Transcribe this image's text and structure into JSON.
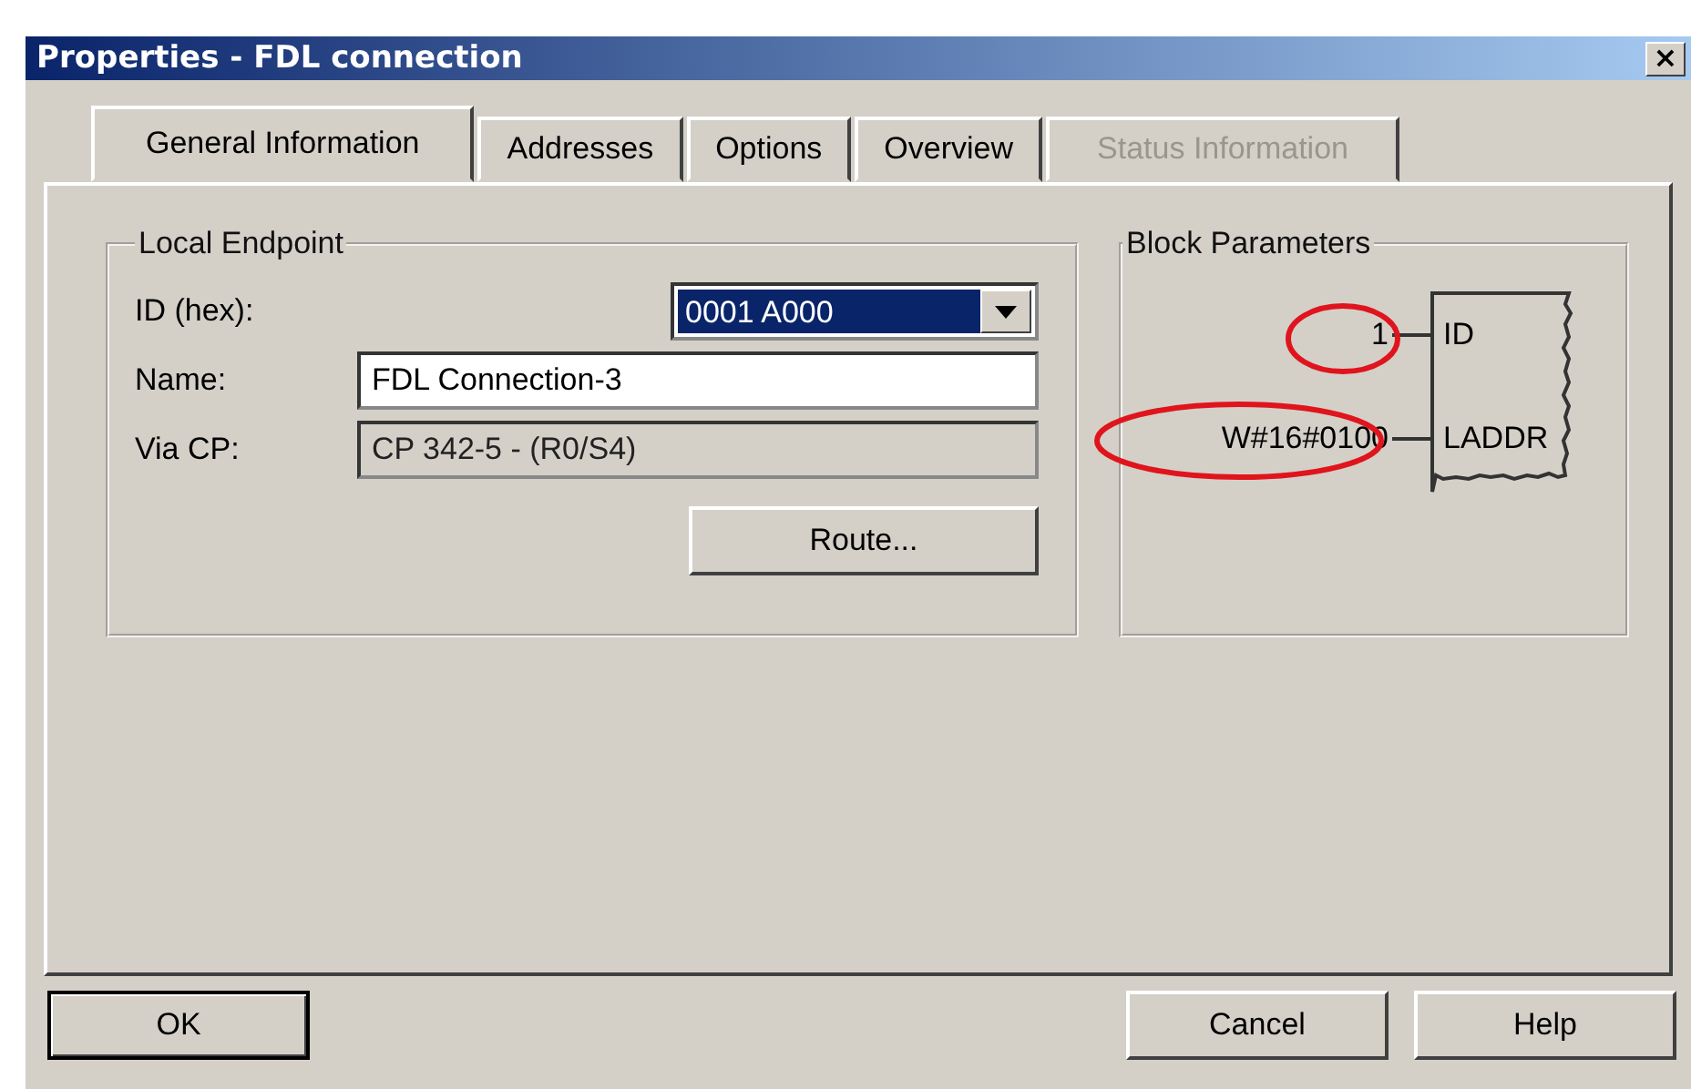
{
  "window": {
    "title": "Properties - FDL connection",
    "close": "×"
  },
  "tabs": [
    {
      "label": "General Information",
      "selected": true,
      "disabled": false
    },
    {
      "label": "Addresses",
      "selected": false,
      "disabled": false
    },
    {
      "label": "Options",
      "selected": false,
      "disabled": false
    },
    {
      "label": "Overview",
      "selected": false,
      "disabled": false
    },
    {
      "label": "Status Information",
      "selected": false,
      "disabled": true
    }
  ],
  "local_endpoint": {
    "title": "Local Endpoint",
    "fields": [
      {
        "kind": "dropdown",
        "label": "ID (hex):",
        "value": "0001 A000",
        "disabled": false
      },
      {
        "kind": "text",
        "label": "Name:",
        "value": "FDL Connection-3",
        "disabled": false
      },
      {
        "kind": "text",
        "label": "Via CP:",
        "value": "CP 342-5 - (R0/S4)",
        "disabled": true
      }
    ],
    "route_button": "Route..."
  },
  "block_parameters": {
    "title": "Block Parameters",
    "parameters": [
      {
        "name": "ID",
        "value": "1",
        "highlighted": true
      },
      {
        "name": "LADDR",
        "value": "W#16#0100",
        "highlighted": true
      }
    ]
  },
  "buttons": [
    {
      "label": "OK",
      "default": true
    },
    {
      "label": "Cancel",
      "default": false
    },
    {
      "label": "Help",
      "default": false
    }
  ]
}
